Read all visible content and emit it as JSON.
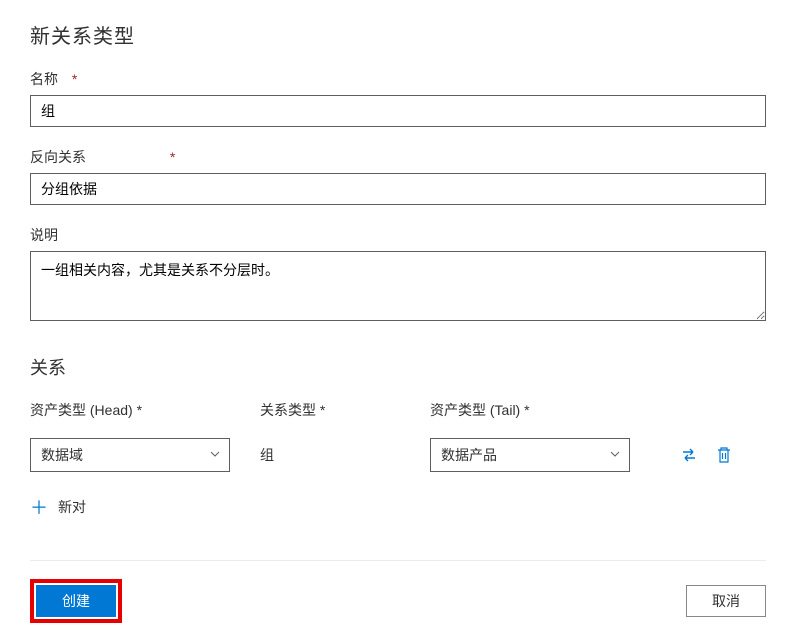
{
  "title": "新关系类型",
  "fields": {
    "name": {
      "label": "名称",
      "value": "组"
    },
    "reverse": {
      "label": "反向关系",
      "value": "分组依据"
    },
    "description": {
      "label": "说明",
      "value": "一组相关内容，尤其是关系不分层时。"
    }
  },
  "section": {
    "title": "关系",
    "columns": {
      "head": "资产类型 (Head) *",
      "type": "关系类型 *",
      "tail": "资产类型 (Tail) *"
    },
    "row": {
      "head_value": "数据域",
      "type_value": "组",
      "tail_value": "数据产品"
    },
    "new_pair": "新对"
  },
  "footer": {
    "create": "创建",
    "cancel": "取消"
  }
}
